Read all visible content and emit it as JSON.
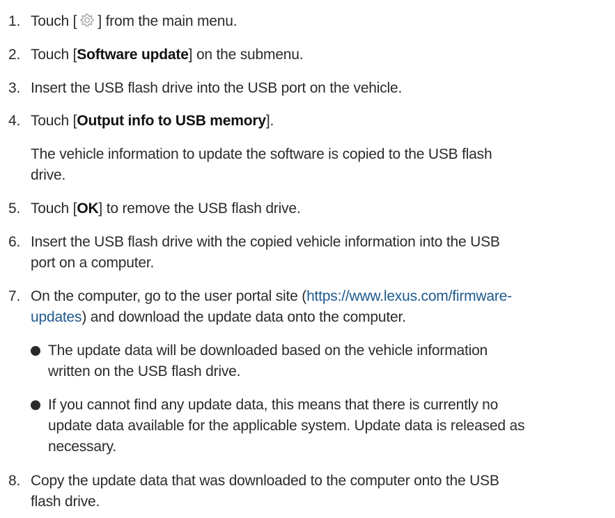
{
  "steps": [
    {
      "num": "1.",
      "pre": "Touch [",
      "post": "] from the main menu.",
      "icon": "gear-icon"
    },
    {
      "num": "2.",
      "pre": "Touch [",
      "bold": "Software update",
      "post": "] on the submenu."
    },
    {
      "num": "3.",
      "text": "Insert the USB flash drive into the USB port on the vehicle."
    },
    {
      "num": "4.",
      "pre": "Touch [",
      "bold": "Output info to USB memory",
      "post": "].",
      "note_line1": "The vehicle information to update the software is copied to the USB flash",
      "note_line2": "drive."
    },
    {
      "num": "5.",
      "pre": "Touch [",
      "bold": "OK",
      "post": "] to remove the USB flash drive."
    },
    {
      "num": "6.",
      "line1": "Insert the USB flash drive with the copied vehicle information into the USB",
      "line2": "port on a computer."
    },
    {
      "num": "7.",
      "pre": "On the computer, go to the user portal site (",
      "link1": "https://www.lexus.com/firmware-",
      "link2": "updates",
      "post": ") and download the update data onto the computer.",
      "bullets": [
        {
          "line1": "The update data will be downloaded based on the vehicle information",
          "line2": "written on the USB flash drive."
        },
        {
          "line1": "If you cannot find any update data, this means that there is currently no",
          "line2": "update data available for the applicable system. Update data is released as",
          "line3": "necessary."
        }
      ]
    },
    {
      "num": "8.",
      "line1": "Copy the update data that was downloaded to the computer onto the USB",
      "line2": "flash drive."
    }
  ]
}
